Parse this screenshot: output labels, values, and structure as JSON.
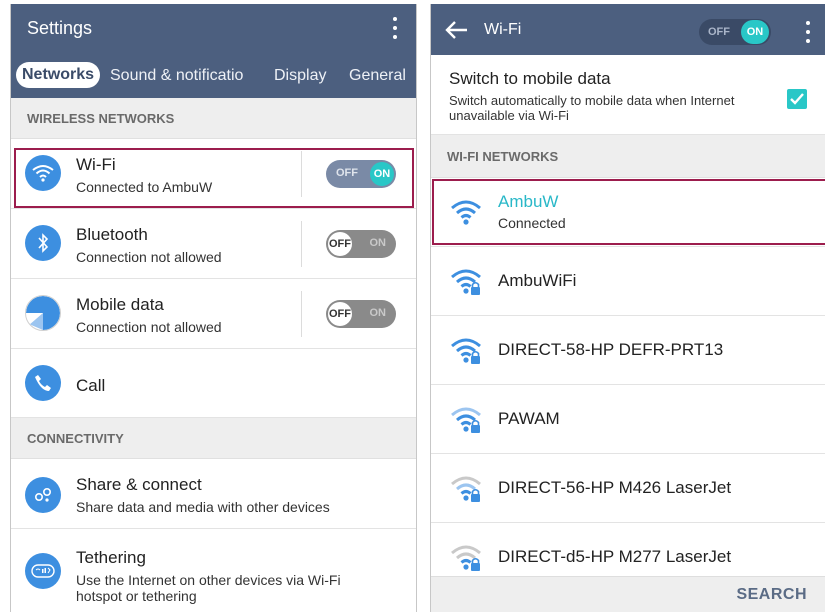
{
  "left": {
    "title": "Settings",
    "tabs": [
      {
        "label": "Networks",
        "active": true
      },
      {
        "label": "Sound & notificatio"
      },
      {
        "label": "Display"
      },
      {
        "label": "General"
      }
    ],
    "sections": {
      "wireless": "WIRELESS NETWORKS",
      "connectivity": "CONNECTIVITY"
    },
    "items": {
      "wifi": {
        "title": "Wi-Fi",
        "subtitle": "Connected to AmbuW",
        "toggle_on": "ON",
        "toggle_off": "OFF"
      },
      "bluetooth": {
        "title": "Bluetooth",
        "subtitle": "Connection not allowed",
        "toggle_on": "ON",
        "toggle_off": "OFF"
      },
      "mobile_data": {
        "title": "Mobile data",
        "subtitle": "Connection not allowed",
        "toggle_on": "ON",
        "toggle_off": "OFF"
      },
      "call": {
        "title": "Call"
      },
      "share": {
        "title": "Share & connect",
        "subtitle": "Share data and media with other devices"
      },
      "tethering": {
        "title": "Tethering",
        "subtitle": "Use the Internet on other devices via Wi-Fi hotspot or tethering"
      }
    }
  },
  "right": {
    "title": "Wi-Fi",
    "master_toggle": {
      "off": "OFF",
      "on": "ON"
    },
    "mobile_switch": {
      "title": "Switch to mobile data",
      "subtitle": "Switch automatically to mobile data when Internet unavailable via Wi-Fi",
      "checked": true
    },
    "section": "WI-FI NETWORKS",
    "networks": [
      {
        "name": "AmbuW",
        "status": "Connected"
      },
      {
        "name": "AmbuWiFi"
      },
      {
        "name": "DIRECT-58-HP DEFR-PRT13"
      },
      {
        "name": "PAWAM"
      },
      {
        "name": "DIRECT-56-HP M426 LaserJet"
      },
      {
        "name": "DIRECT-d5-HP M277 LaserJet"
      }
    ],
    "search_label": "SEARCH"
  },
  "colors": {
    "appbar": "#4c5f7f",
    "accent": "#29c7c7",
    "icon_blue": "#3d8fe0",
    "highlight": "#9c1d4d"
  }
}
